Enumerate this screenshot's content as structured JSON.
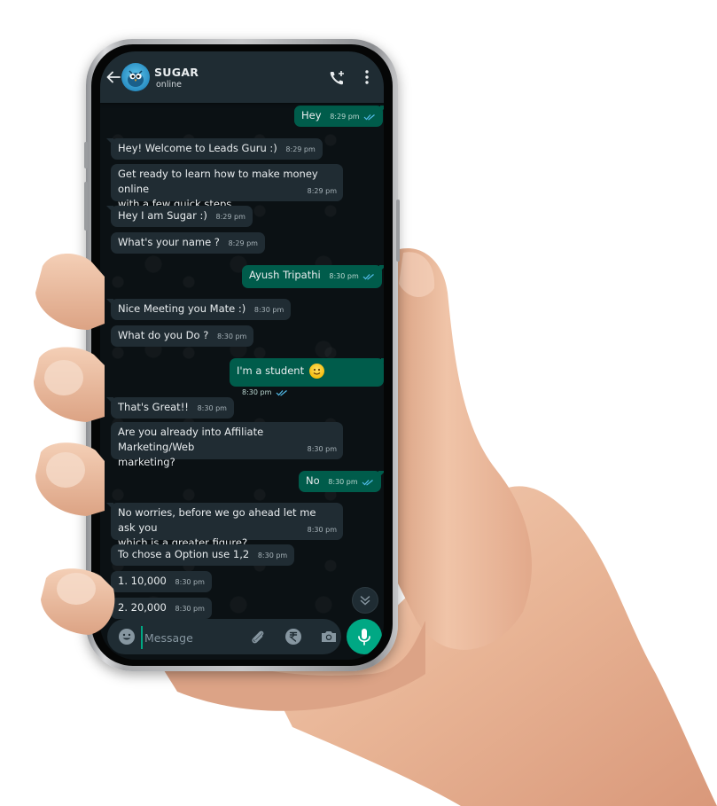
{
  "header": {
    "contact_name": "SUGAR",
    "contact_status": "online",
    "icons": {
      "back": "arrow-left-icon",
      "call": "add-call-icon",
      "menu": "more-vert-icon",
      "avatar": "bird-avatar"
    }
  },
  "messages": [
    {
      "dir": "out",
      "text": "Hey",
      "time": "8:29 pm",
      "read": true
    },
    {
      "dir": "in",
      "text": "Hey! Welcome to Leads Guru :)",
      "time": "8:29 pm"
    },
    {
      "dir": "in",
      "text": "Get ready to learn how to make money online\nwith a few quick steps..",
      "time": "8:29 pm"
    },
    {
      "dir": "in",
      "text": "Hey I am Sugar :)",
      "time": "8:29 pm"
    },
    {
      "dir": "in",
      "text": "What's your name ?",
      "time": "8:29 pm"
    },
    {
      "dir": "out",
      "text": "Ayush Tripathi",
      "time": "8:30 pm",
      "read": true
    },
    {
      "dir": "in",
      "text": "Nice Meeting you Mate :)",
      "time": "8:30 pm"
    },
    {
      "dir": "in",
      "text": "What do you Do ?",
      "time": "8:30 pm"
    },
    {
      "dir": "out",
      "text": "I'm a student",
      "emoji": "smiling-face-emoji",
      "time": "8:30 pm",
      "read": true
    },
    {
      "dir": "in",
      "text": "That's Great!!",
      "time": "8:30 pm"
    },
    {
      "dir": "in",
      "text": "Are you already into Affiliate Marketing/Web\nmarketing?",
      "time": "8:30 pm"
    },
    {
      "dir": "out",
      "text": "No",
      "time": "8:30 pm",
      "read": true
    },
    {
      "dir": "in",
      "text": "No worries, before we go ahead let me ask you\nwhich is a greater figure?",
      "time": "8:30 pm"
    },
    {
      "dir": "in",
      "text": "To chose a Option use 1,2",
      "time": "8:30 pm"
    },
    {
      "dir": "in",
      "text": "1. 10,000",
      "time": "8:30 pm"
    },
    {
      "dir": "in",
      "text": "2. 20,000",
      "time": "8:30 pm"
    }
  ],
  "composer": {
    "placeholder": "Message",
    "icons": {
      "emoji": "smiley-icon",
      "attach": "paperclip-icon",
      "payment": "rupee-icon",
      "camera": "camera-icon",
      "mic": "mic-icon",
      "scroll": "double-chevron-down-icon"
    }
  },
  "colors": {
    "header_bg": "#1f2c33",
    "chat_bg": "#0b1114",
    "incoming_bubble": "#202c33",
    "outgoing_bubble": "#005c4b",
    "accent": "#00a884",
    "read_tick": "#53bdeb"
  }
}
